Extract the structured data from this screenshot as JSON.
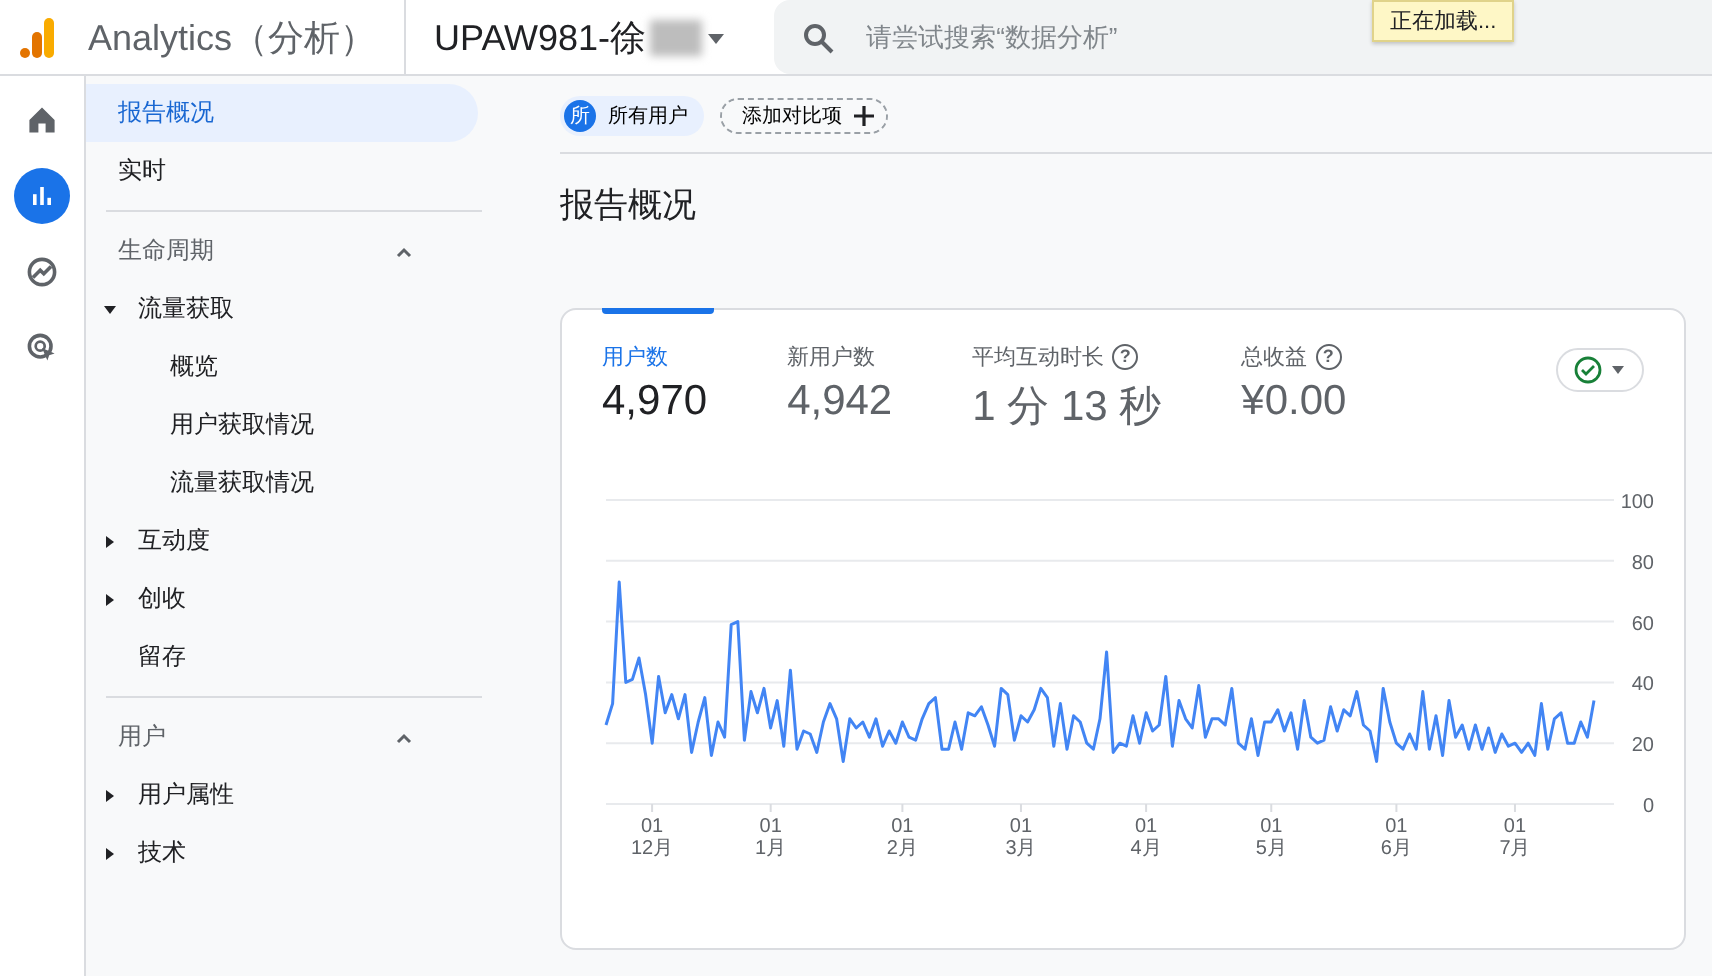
{
  "header": {
    "title": "Analytics（分析）",
    "property": "UPAW981-徐",
    "search": {
      "placeholder": "请尝试搜索“数据分析”"
    },
    "tooltip": "正在加载..."
  },
  "rail": [
    {
      "selected": false
    },
    {
      "selected": true
    },
    {
      "selected": false
    },
    {
      "selected": false
    }
  ],
  "nav": {
    "items": [
      {
        "label": "报告概况",
        "selected": true
      },
      {
        "label": "实时",
        "selected": false
      }
    ],
    "sections": [
      {
        "title": "生命周期",
        "expanded": true,
        "items": [
          {
            "label": "流量获取",
            "selected": false,
            "expanded": true,
            "children": [
              {
                "label": "概览",
                "selected": false
              },
              {
                "label": "用户获取情况",
                "selected": false
              },
              {
                "label": "流量获取情况",
                "selected": false
              }
            ]
          },
          {
            "label": "互动度",
            "selected": false,
            "expanded": false
          },
          {
            "label": "创收",
            "selected": false,
            "expanded": false
          },
          {
            "label": "留存",
            "selected": false
          }
        ]
      },
      {
        "title": "用户",
        "expanded": true,
        "items": [
          {
            "label": "用户属性",
            "selected": false,
            "expanded": false
          },
          {
            "label": "技术",
            "selected": false,
            "expanded": false
          }
        ]
      }
    ]
  },
  "chips": {
    "segment": {
      "badge": "所",
      "label": "所有用户"
    },
    "add": "添加对比项"
  },
  "page_title": "报告概况",
  "card": {
    "metrics": [
      {
        "label": "用户数",
        "value": "4,970",
        "selected": true
      },
      {
        "label": "新用户数",
        "value": "4,942",
        "selected": false
      },
      {
        "label": "平均互动时长",
        "value": "1 分 13 秒",
        "selected": false,
        "help": "?"
      },
      {
        "label": "总收益",
        "value": "¥0.00",
        "selected": false,
        "help": "?"
      }
    ],
    "chart_data": {
      "type": "line",
      "grid": true,
      "ylim": [
        0,
        100
      ],
      "categories": [
        null,
        null,
        null,
        null,
        null,
        null,
        null,
        "01\n12月",
        null,
        null,
        null,
        null,
        null,
        null,
        null,
        null,
        null,
        null,
        null,
        null,
        null,
        null,
        null,
        null,
        null,
        "01\n1月",
        null,
        null,
        null,
        null,
        null,
        null,
        null,
        null,
        null,
        null,
        null,
        null,
        null,
        null,
        null,
        null,
        null,
        null,
        null,
        "01\n2月",
        null,
        null,
        null,
        null,
        null,
        null,
        null,
        null,
        null,
        null,
        null,
        null,
        null,
        null,
        null,
        null,
        null,
        "01\n3月",
        null,
        null,
        null,
        null,
        null,
        null,
        null,
        null,
        null,
        null,
        null,
        null,
        null,
        null,
        null,
        null,
        null,
        null,
        "01\n4月",
        null,
        null,
        null,
        null,
        null,
        null,
        null,
        null,
        null,
        null,
        null,
        null,
        null,
        null,
        null,
        null,
        null,
        null,
        "01\n5月",
        null,
        null,
        null,
        null,
        null,
        null,
        null,
        null,
        null,
        null,
        null,
        null,
        null,
        null,
        null,
        null,
        null,
        null,
        "01\n6月",
        null,
        null,
        null,
        null,
        null,
        null,
        null,
        null,
        null,
        null,
        null,
        null,
        null,
        null,
        null,
        null,
        null,
        "01\n7月",
        null,
        null,
        null,
        null,
        null,
        null,
        null,
        null,
        null,
        null,
        null,
        null
      ],
      "yticks": [
        0,
        20,
        40,
        60,
        80,
        100
      ],
      "series": [
        {
          "color": "#4285f4",
          "values": [
            26,
            33,
            73,
            40,
            41,
            48,
            36,
            20,
            42,
            30,
            36,
            28,
            36,
            17,
            27,
            35,
            16,
            27,
            22,
            59,
            60,
            21,
            37,
            30,
            38,
            25,
            34,
            19,
            44,
            18,
            24,
            23,
            17,
            27,
            33,
            28,
            14,
            28,
            25,
            27,
            22,
            28,
            19,
            24,
            20,
            27,
            22,
            21,
            28,
            33,
            35,
            18,
            18,
            27,
            18,
            30,
            29,
            32,
            26,
            19,
            38,
            36,
            21,
            29,
            27,
            31,
            38,
            35,
            19,
            33,
            18,
            29,
            27,
            20,
            18,
            28,
            50,
            17,
            20,
            19,
            29,
            20,
            30,
            24,
            26,
            42,
            19,
            34,
            28,
            25,
            39,
            22,
            28,
            28,
            26,
            38,
            20,
            18,
            28,
            16,
            27,
            27,
            31,
            24,
            30,
            18,
            34,
            22,
            20,
            21,
            32,
            24,
            31,
            29,
            37,
            26,
            24,
            14,
            38,
            27,
            20,
            18,
            23,
            18,
            37,
            18,
            29,
            16,
            34,
            22,
            26,
            18,
            26,
            18,
            25,
            17,
            23,
            19,
            20,
            17,
            20,
            16,
            33,
            18,
            28,
            30,
            20,
            20,
            27,
            22,
            34
          ]
        }
      ]
    }
  }
}
